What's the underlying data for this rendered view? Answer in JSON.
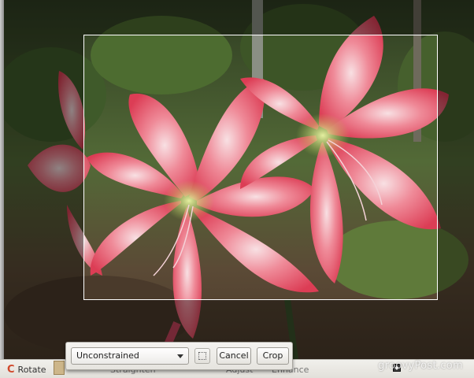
{
  "toolbar": {
    "rotate_label": "Rotate",
    "hidden_tools": [
      "Straighten",
      "Adjust",
      "Enhance"
    ]
  },
  "crop_popup": {
    "constraint_value": "Unconstrained",
    "cancel_label": "Cancel",
    "crop_label": "Crop"
  },
  "watermark": "groovyPost.com",
  "colors": {
    "accent_rotate": "#d1482b",
    "petal": "#e8546a",
    "petal_light": "#f6c6cf",
    "flower_center": "#cfe07a",
    "foliage": "#4f6a34",
    "toolbar": "#e8e6e1"
  }
}
